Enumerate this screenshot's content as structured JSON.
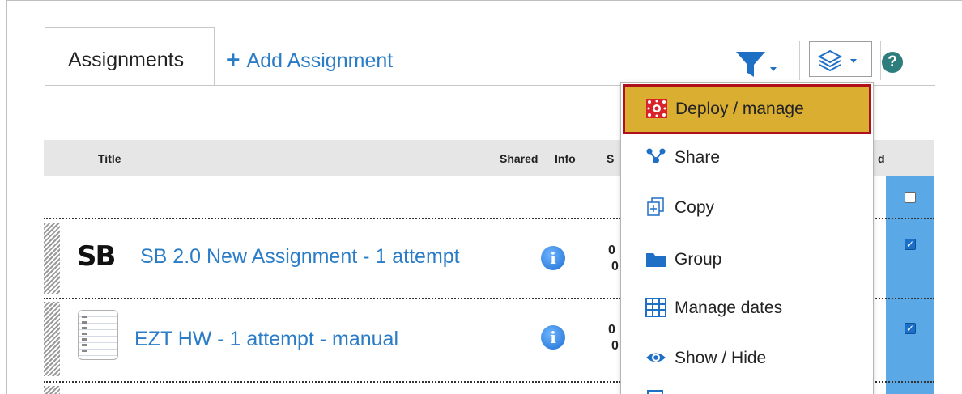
{
  "tabs": {
    "active_label": "Assignments",
    "add_label": "Add Assignment"
  },
  "table": {
    "headers": {
      "title": "Title",
      "shared": "Shared",
      "info": "Info",
      "clipped_s": "S",
      "clipped_d": "d"
    },
    "rows": [
      {
        "title": "SB 2.0 New Assignment - 1 attempt",
        "logo": "SB",
        "icon": "sb-logo-icon",
        "date_top": "0",
        "date_bottom": "0",
        "checked": true
      },
      {
        "title": "EZT HW - 1 attempt - manual",
        "icon": "notebook-icon",
        "date_top": "0",
        "date_bottom": "0",
        "checked": true
      }
    ]
  },
  "menu": {
    "items": [
      {
        "label": "Deploy / manage",
        "icon": "deploy-icon",
        "highlighted": true
      },
      {
        "label": "Share",
        "icon": "share-icon"
      },
      {
        "label": "Copy",
        "icon": "copy-icon"
      },
      {
        "label": "Group",
        "icon": "folder-icon"
      },
      {
        "label": "Manage dates",
        "icon": "calendar-grid-icon"
      },
      {
        "label": "Show / Hide",
        "icon": "eye-icon"
      }
    ]
  },
  "toolbar": {
    "help_glyph": "?"
  },
  "colors": {
    "link": "#2a7cc7",
    "highlight_bg": "#d9ae31",
    "highlight_border": "#b0101c",
    "selection_column": "#5aa9e6"
  }
}
